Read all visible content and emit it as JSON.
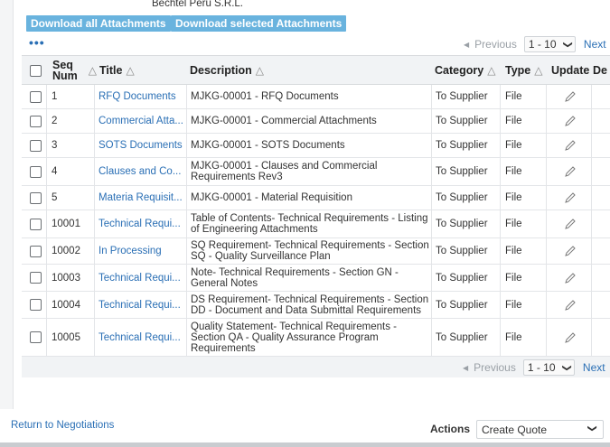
{
  "header": {
    "company": "Bechtel Peru S.R.L.",
    "download_all_label": "Download all Attachments",
    "download_selected_label": "Download selected Attachments",
    "more_label": "•••"
  },
  "pager": {
    "previous_label": "Previous",
    "range_value": "1 - 10",
    "next_label": "Next"
  },
  "table": {
    "columns": {
      "seq_line1": "Seq",
      "seq_line2": "Num",
      "title": "Title",
      "description": "Description",
      "category": "Category",
      "type": "Type",
      "update": "Update",
      "delete": "De"
    },
    "rows": [
      {
        "seq": "1",
        "title": "RFQ Documents",
        "description": "MJKG-00001 - RFQ Documents",
        "category": "To Supplier",
        "type": "File"
      },
      {
        "seq": "2",
        "title": "Commercial Atta...",
        "description": "MJKG-00001 - Commercial Attachments",
        "category": "To Supplier",
        "type": "File"
      },
      {
        "seq": "3",
        "title": "SOTS Documents",
        "description": "MJKG-00001 - SOTS Documents",
        "category": "To Supplier",
        "type": "File"
      },
      {
        "seq": "4",
        "title": "Clauses and Co...",
        "description": "MJKG-00001 - Clauses and Commercial Requirements Rev3",
        "category": "To Supplier",
        "type": "File"
      },
      {
        "seq": "5",
        "title": "Materia Requisit...",
        "description": "MJKG-00001 - Material Requisition",
        "category": "To Supplier",
        "type": "File"
      },
      {
        "seq": "10001",
        "title": "Technical Requi...",
        "description": "Table of Contents- Technical Requirements - Listing of Engineering Attachments",
        "category": "To Supplier",
        "type": "File"
      },
      {
        "seq": "10002",
        "title": "In Processing",
        "description": "SQ Requirement- Technical Requirements - Section SQ - Quality Surveillance Plan",
        "category": "To Supplier",
        "type": "File"
      },
      {
        "seq": "10003",
        "title": "Technical Requi...",
        "description": "Note- Technical Requirements - Section GN - General Notes",
        "category": "To Supplier",
        "type": "File"
      },
      {
        "seq": "10004",
        "title": "Technical Requi...",
        "description": "DS Requirement- Technical Requirements - Section DD - Document and Data Submittal Requirements",
        "category": "To Supplier",
        "type": "File"
      },
      {
        "seq": "10005",
        "title": "Technical Requi...",
        "description": "Quality Statement- Technical Requirements - Section QA - Quality Assurance Program Requirements",
        "category": "To Supplier",
        "type": "File"
      }
    ]
  },
  "footer": {
    "return_link": "Return to Negotiations",
    "actions_label": "Actions",
    "actions_value": "Create Quote"
  },
  "icons": {
    "sort": "triangle-up-icon",
    "update": "pencil-icon",
    "previous": "triangle-left-icon",
    "dropdown": "chevron-down-icon"
  },
  "colors": {
    "button_bg": "#69b3de",
    "link": "#2a6fb5",
    "header_bg": "#f1f3f5"
  }
}
